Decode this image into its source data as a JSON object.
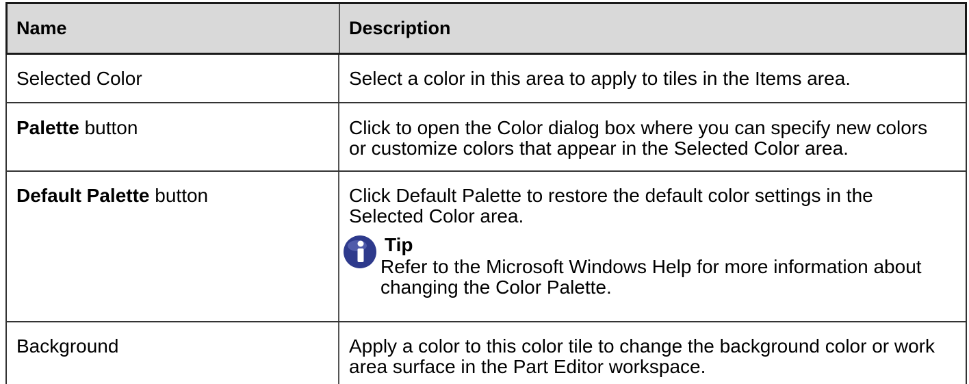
{
  "table": {
    "headers": [
      "Name",
      "Description"
    ],
    "rows": [
      {
        "name_bold": "",
        "name_rest": "Selected Color",
        "description": "Select a color in this area to apply to tiles in the Items area."
      },
      {
        "name_bold": "Palette",
        "name_rest": " button",
        "description": "Click to open the Color dialog box where you can specify new colors or customize colors that appear in the Selected Color area."
      },
      {
        "name_bold": "Default Palette",
        "name_rest": " button",
        "description": "Click Default Palette to restore the default color settings in the Selected Color area.",
        "tip": {
          "icon": "info-icon",
          "title": "Tip",
          "text": "Refer to the Microsoft Windows Help for more information about changing the Color Palette."
        }
      },
      {
        "name_bold": "",
        "name_rest": "Background",
        "description": "Apply a color to this color tile to change the background color or work area surface in the Part Editor workspace."
      }
    ]
  },
  "colors": {
    "header_bg": "#d9d9d9",
    "tip_icon": "#2e3a8c",
    "border": "#333333"
  }
}
